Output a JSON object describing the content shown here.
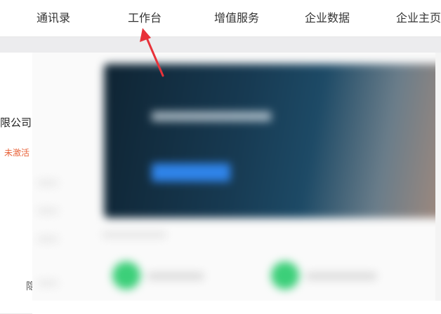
{
  "nav": {
    "items": [
      {
        "label": "通讯录"
      },
      {
        "label": "工作台"
      },
      {
        "label": "增值服务"
      },
      {
        "label": "企业数据"
      },
      {
        "label": "企业主页"
      }
    ]
  },
  "left": {
    "company_name": "限公司",
    "status": "未激活",
    "bottom_text": "隐"
  },
  "colors": {
    "arrow": "#e8323a",
    "status": "#e8633a",
    "accent_button": "#2f84ea",
    "green_icon": "#3ccf79"
  }
}
